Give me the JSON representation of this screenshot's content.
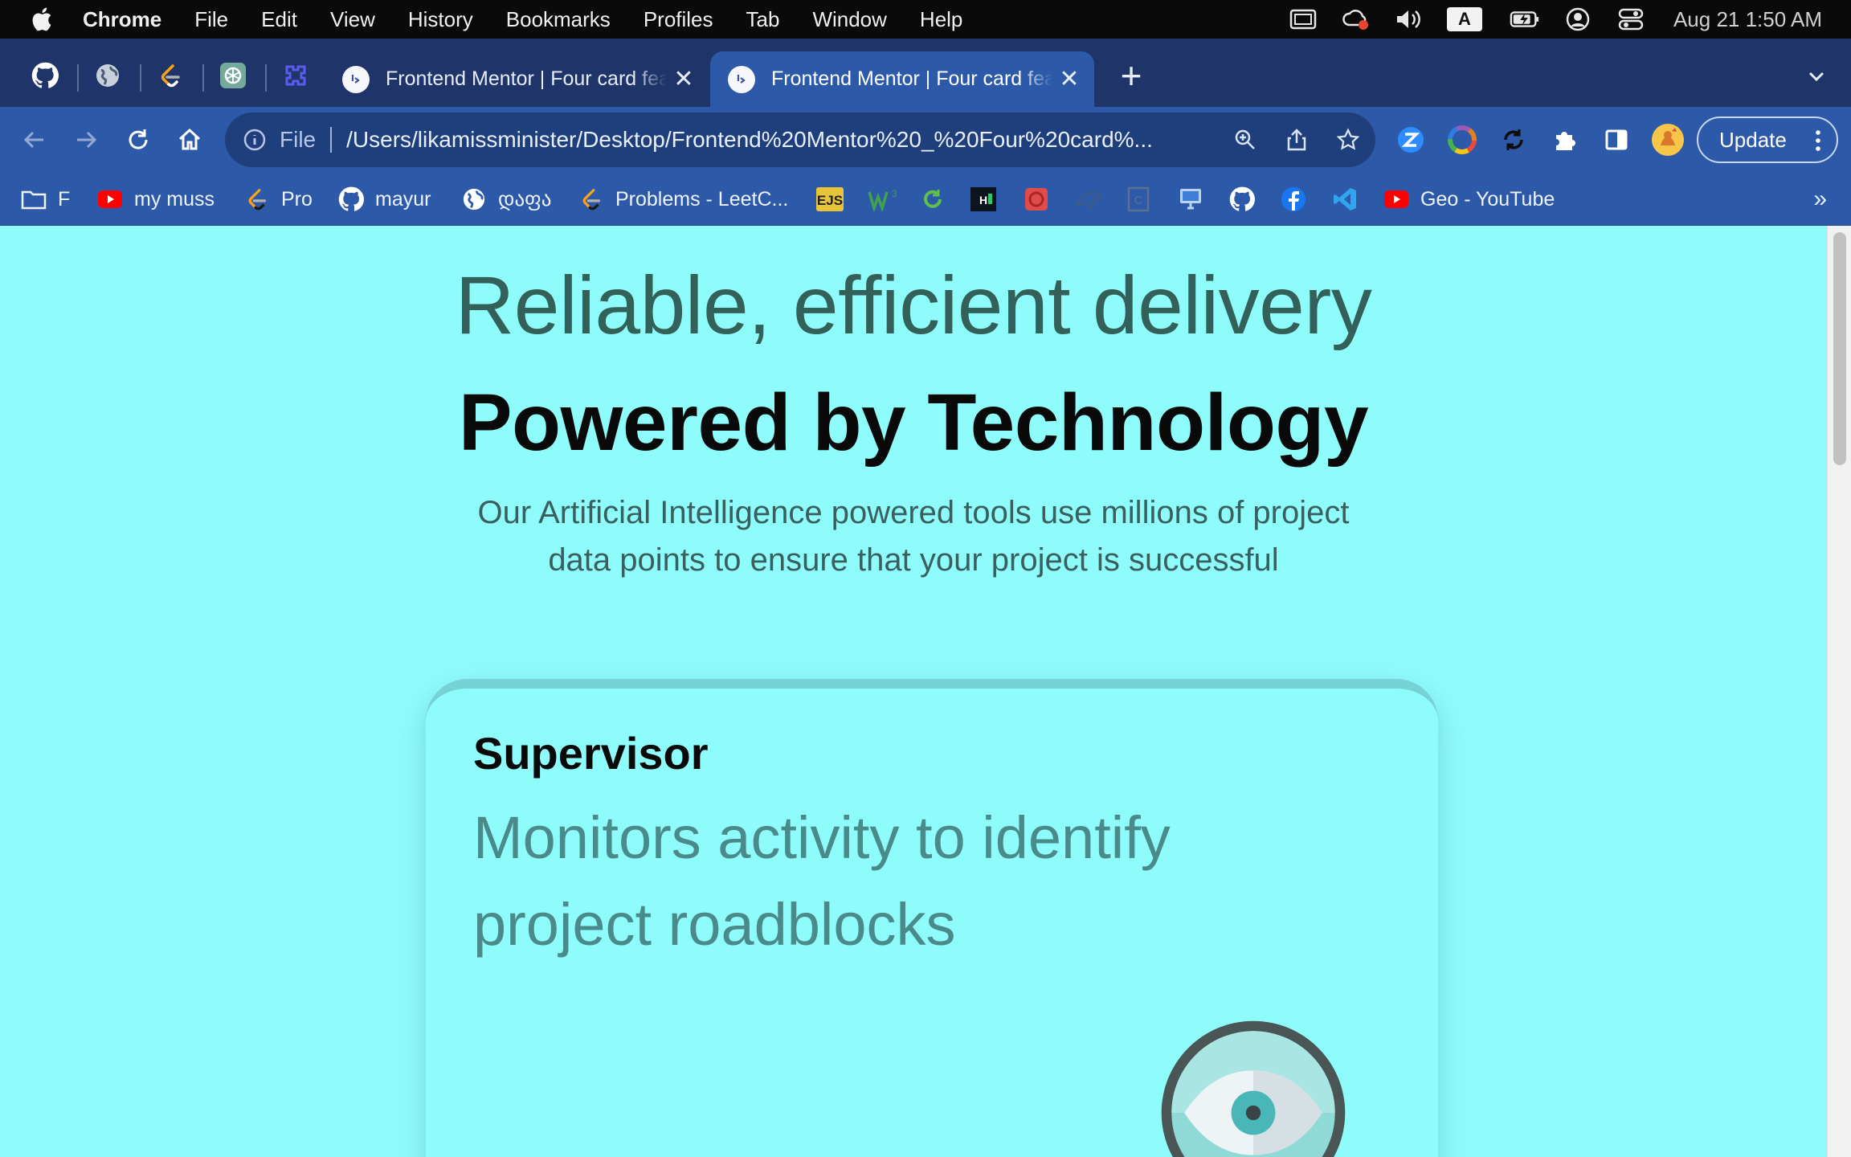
{
  "menubar": {
    "app_name": "Chrome",
    "items": [
      "File",
      "Edit",
      "View",
      "History",
      "Bookmarks",
      "Profiles",
      "Tab",
      "Window",
      "Help"
    ],
    "input_source": "A",
    "clock": "Aug 21  1:50 AM"
  },
  "tabs": {
    "pinned": [
      "github-icon",
      "globe-icon",
      "leetcode-icon",
      "chatgpt-icon",
      "extension-icon"
    ],
    "items": [
      {
        "title": "Frontend Mentor | Four card feature section",
        "active": false
      },
      {
        "title": "Frontend Mentor | Four card feature section",
        "active": true
      }
    ],
    "close_glyph": "✕",
    "new_tab_glyph": "+"
  },
  "toolbar": {
    "scheme": "File",
    "url": "/Users/likamissminister/Desktop/Frontend%20Mentor%20_%20Four%20card%...",
    "update_label": "Update"
  },
  "bookmarks": {
    "items": [
      {
        "label": "F",
        "icon": "folder-icon"
      },
      {
        "label": "my muss",
        "icon": "youtube-icon"
      },
      {
        "label": "Pro",
        "icon": "leetcode-icon"
      },
      {
        "label": "mayur",
        "icon": "github-icon"
      },
      {
        "label": "დაფა",
        "icon": "globe-icon"
      },
      {
        "label": "Problems - LeetC...",
        "icon": "leetcode-icon"
      },
      {
        "label": "Geo - YouTube",
        "icon": "youtube-icon"
      }
    ],
    "more_glyph": "»"
  },
  "page": {
    "heading_light": "Reliable, efficient delivery",
    "heading_bold": "Powered by Technology",
    "description": "Our Artificial Intelligence powered tools use millions of project data points to ensure that your project is successful",
    "card": {
      "title": "Supervisor",
      "text": "Monitors activity to identify project roadblocks",
      "icon": "eye-icon"
    }
  },
  "colors": {
    "page_bg": "#8ffcfc",
    "chrome_frame": "#1f3569",
    "toolbar": "#2d5aa8",
    "card_border": "#76d2d4",
    "heading_light": "#34605a"
  }
}
